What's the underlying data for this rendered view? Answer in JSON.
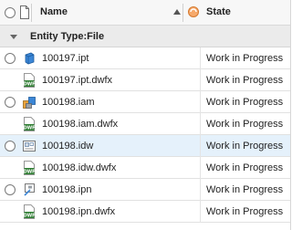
{
  "columns": {
    "name": "Name",
    "state": "State"
  },
  "group": {
    "label": "Entity Type:File"
  },
  "rows": [
    {
      "name": "100197.ipt",
      "state": "Work in Progress",
      "icon": "part-icon",
      "has_radio": true,
      "selected": false
    },
    {
      "name": "100197.ipt.dwfx",
      "state": "Work in Progress",
      "icon": "dwf-icon",
      "has_radio": false,
      "selected": false
    },
    {
      "name": "100198.iam",
      "state": "Work in Progress",
      "icon": "assembly-icon",
      "has_radio": true,
      "selected": false
    },
    {
      "name": "100198.iam.dwfx",
      "state": "Work in Progress",
      "icon": "dwf-icon",
      "has_radio": false,
      "selected": false
    },
    {
      "name": "100198.idw",
      "state": "Work in Progress",
      "icon": "drawing-icon",
      "has_radio": true,
      "selected": true
    },
    {
      "name": "100198.idw.dwfx",
      "state": "Work in Progress",
      "icon": "dwf-icon",
      "has_radio": false,
      "selected": false
    },
    {
      "name": "100198.ipn",
      "state": "Work in Progress",
      "icon": "presentation-icon",
      "has_radio": true,
      "selected": false
    },
    {
      "name": "100198.ipn.dwfx",
      "state": "Work in Progress",
      "icon": "dwf-icon",
      "has_radio": false,
      "selected": false
    }
  ],
  "colors": {
    "selected_row": "#e5f1fb",
    "dwf_green": "#2e7d32",
    "part_blue": "#2f78c4"
  }
}
